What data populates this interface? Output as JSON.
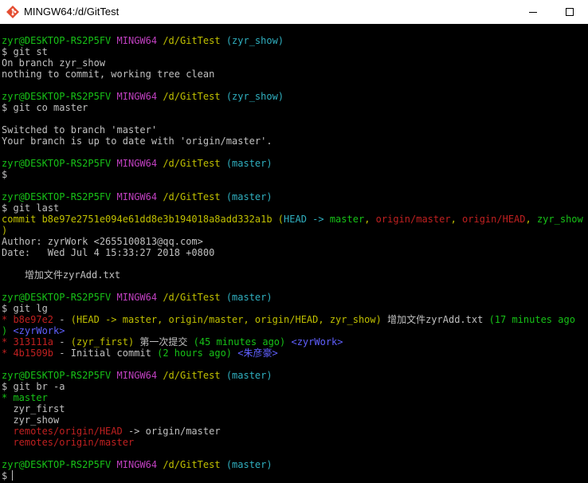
{
  "window": {
    "title": "MINGW64:/d/GitTest"
  },
  "prompt": {
    "user": "zyr@DESKTOP-RS2P5FV",
    "env": "MINGW64",
    "path": "/d/GitTest",
    "branch_show": "(zyr_show)",
    "branch_master": "(master)",
    "symbol": "$"
  },
  "cmd1": {
    "text": "git st",
    "out1": "On branch zyr_show",
    "out2": "nothing to commit, working tree clean"
  },
  "cmd2": {
    "text": "git co master",
    "out1": "Switched to branch 'master'",
    "out2": "Your branch is up to date with 'origin/master'."
  },
  "cmd4": {
    "text": "git last",
    "commit_label": "commit b8e97e2751e094e61dd8e3b194018a8add332a1b",
    "refs_open": "(",
    "head": "HEAD -> ",
    "master": "master",
    "comma": ", ",
    "origin_master": "origin/master",
    "origin_head": "origin/HEAD",
    "zyr_show": "zyr_show",
    "refs_close": ")",
    "author": "Author: zyrWork <2655100813@qq.com>",
    "date": "Date:   Wed Jul 4 15:33:27 2018 +0800",
    "message": "    增加文件zyrAdd.txt"
  },
  "cmd5": {
    "text": "git lg",
    "star": "* ",
    "c1": {
      "hash": "b8e97e2",
      "dash": " - ",
      "refs": "(HEAD -> master, origin/master, origin/HEAD, zyr_show)",
      "msg": " 增加文件zyrAdd.txt ",
      "time_a": "(17 minutes ago",
      "time_b": ")",
      "author": " <zyrWork>"
    },
    "c2": {
      "hash": "313111a",
      "dash": " - ",
      "refs": "(zyr_first)",
      "msg": " 第一次提交 ",
      "time": "(45 minutes ago)",
      "author": " <zyrWork>"
    },
    "c3": {
      "hash": "4b1509b",
      "dash": " - ",
      "msg": "Initial commit ",
      "time": "(2 hours ago)",
      "author": " <朱彦豪>"
    }
  },
  "cmd6": {
    "text": "git br -a",
    "current_marker": "* ",
    "current": "master",
    "branches": [
      "  zyr_first",
      "  zyr_show"
    ],
    "remote_head": "  remotes/origin/HEAD",
    "remote_head_arrow": " -> origin/master",
    "remote_master": "  remotes/origin/master"
  }
}
